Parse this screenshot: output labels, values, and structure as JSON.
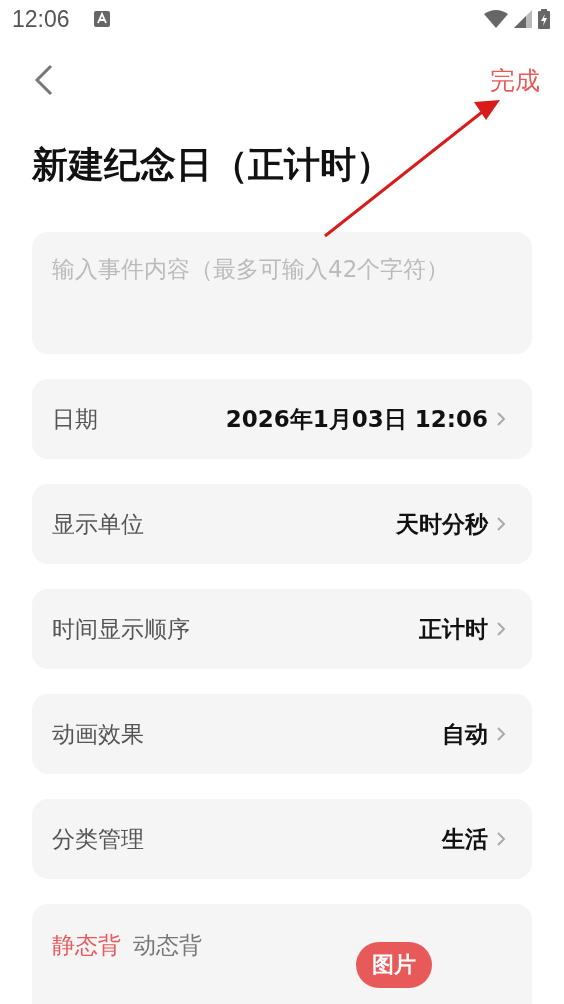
{
  "status_bar": {
    "time": "12:06"
  },
  "header": {
    "done": "完成"
  },
  "title": "新建纪念日（正计时）",
  "event_input": {
    "placeholder": "输入事件内容（最多可输入42个字符）"
  },
  "settings": [
    {
      "label": "日期",
      "value": "2026年1月03日 12:06"
    },
    {
      "label": "显示单位",
      "value": "天时分秒"
    },
    {
      "label": "时间显示顺序",
      "value": "正计时"
    },
    {
      "label": "动画效果",
      "value": "自动"
    },
    {
      "label": "分类管理",
      "value": "生活"
    }
  ],
  "background": {
    "tabs": [
      {
        "label": "静态背",
        "selected": true
      },
      {
        "label": "动态背",
        "selected": false
      }
    ],
    "pill": "图片"
  }
}
